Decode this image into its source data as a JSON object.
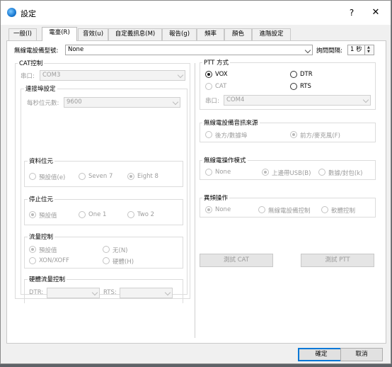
{
  "window": {
    "title": "設定",
    "help": "?",
    "close": "✕"
  },
  "tabs": [
    "一般(l)",
    "電臺(R)",
    "音效(u)",
    "自定義訊息(M)",
    "報告(g)",
    "頻率",
    "顏色",
    "進階設定"
  ],
  "radio_model": {
    "label": "無線電設備型號:",
    "value": "None"
  },
  "poll": {
    "label": "詢問間隔:",
    "value": "1 秒"
  },
  "cat": {
    "title": "CAT控制",
    "port_label": "串口:",
    "port_value": "COM3",
    "conn_title": "連接埠設定",
    "baud_label": "每秒位元數:",
    "baud_value": "9600",
    "data_bits": {
      "title": "資料位元",
      "options": [
        "預設值(e)",
        "Seven 7",
        "Eight 8"
      ],
      "selected": 2
    },
    "stop_bits": {
      "title": "停止位元",
      "options": [
        "預設值",
        "One 1",
        "Two 2"
      ],
      "selected": 0
    },
    "flow": {
      "title": "流量控制",
      "options": [
        "預設值",
        "无(N)",
        "XON/XOFF",
        "硬體(H)"
      ],
      "selected": 0
    },
    "hw_flow": {
      "title": "硬體流量控制",
      "dtr_label": "DTR:",
      "rts_label": "RTS:",
      "dtr_value": "",
      "rts_value": ""
    }
  },
  "ptt": {
    "title": "PTT 方式",
    "options": [
      "VOX",
      "DTR",
      "CAT",
      "RTS"
    ],
    "selected": 0,
    "port_label": "串口:",
    "port_value": "COM4"
  },
  "audio_source": {
    "title": "無線電設備音訊來源",
    "options": [
      "後方/數據埠",
      "前方/麥克風(F)"
    ],
    "selected": 1
  },
  "mode": {
    "title": "無線電操作模式",
    "options": [
      "None",
      "上邊帶USB(B)",
      "數據/封包(k)"
    ],
    "selected": 1
  },
  "split": {
    "title": "異頻操作",
    "options": [
      "None",
      "無線電設備控制",
      "軟體控制"
    ],
    "selected": 0
  },
  "test_cat": "測試 CAT",
  "test_ptt": "測試 PTT",
  "ok": "確定",
  "cancel": "取消"
}
